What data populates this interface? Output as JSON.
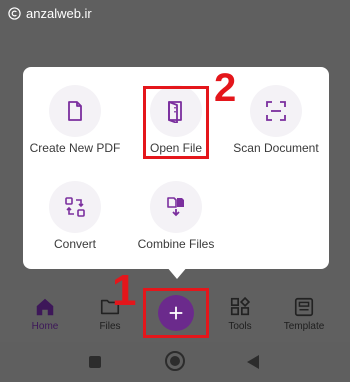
{
  "watermark": {
    "text": "anzalweb.ir",
    "icon": "copyright-icon"
  },
  "popup": {
    "actions": [
      {
        "id": "create-new-pdf",
        "label": "Create New PDF",
        "icon": "document-icon"
      },
      {
        "id": "open-file",
        "label": "Open File",
        "icon": "open-file-icon"
      },
      {
        "id": "scan-document",
        "label": "Scan Document",
        "icon": "scan-frame-icon"
      },
      {
        "id": "convert",
        "label": "Convert",
        "icon": "convert-arrows-icon"
      },
      {
        "id": "combine-files",
        "label": "Combine Files",
        "icon": "combine-files-icon"
      }
    ]
  },
  "annotations": {
    "step1": "1",
    "step2": "2",
    "highlight_color": "#e4161b"
  },
  "bottom_nav": {
    "items": [
      {
        "label": "Home",
        "icon": "home-icon",
        "active": true
      },
      {
        "label": "Files",
        "icon": "folder-icon",
        "active": false
      },
      {
        "label": "Tools",
        "icon": "tools-grid-icon",
        "active": false
      },
      {
        "label": "Template",
        "icon": "template-icon",
        "active": false
      }
    ],
    "fab_icon": "plus-icon",
    "accent_color": "#6b2a8c"
  },
  "system_nav": {
    "icons": [
      "recents-square-icon",
      "home-circle-icon",
      "back-triangle-icon"
    ]
  }
}
